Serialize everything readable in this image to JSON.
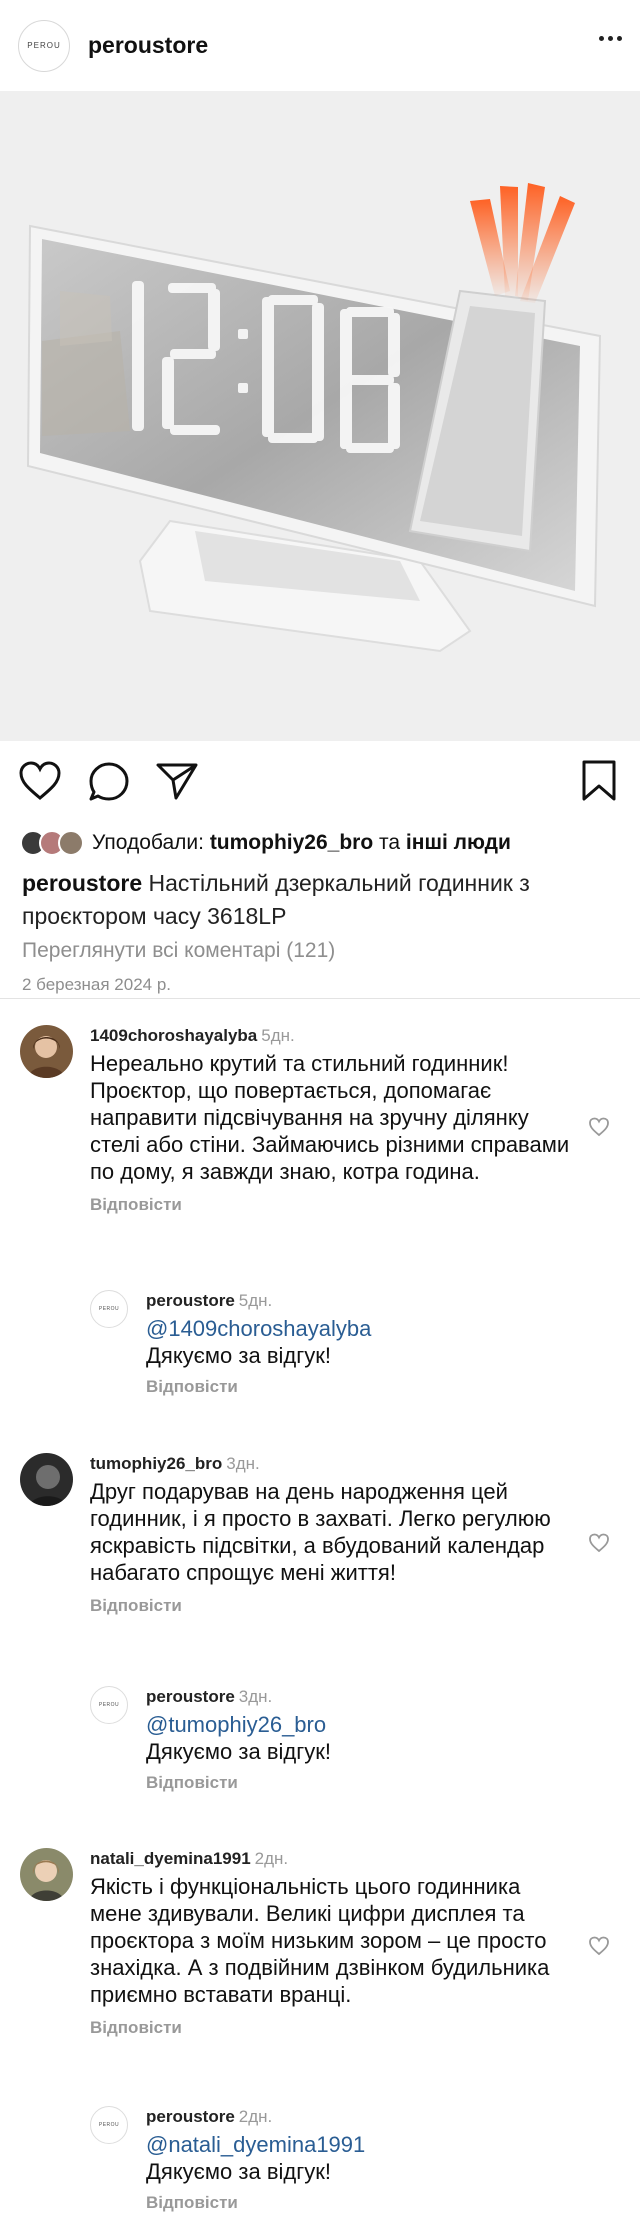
{
  "header": {
    "logo_text": "PEROU",
    "account": "peroustore"
  },
  "post": {
    "likes_prefix": "Уподобали:",
    "likes_user": "tumophiy26_bro",
    "likes_and": "та",
    "likes_others": "інші люди",
    "caption_user": "peroustore",
    "caption_text": "Настільний дзеркальний годинник з проєктором часу 3618LP",
    "view_comments": "Переглянути всі коментарі (121)",
    "date": "2 березная 2024 р."
  },
  "comments": [
    {
      "user": "1409choroshayalyba",
      "time": "5дн.",
      "text": "Нереально крутий та стильний годинник! Проєктор, що повертається, допомагає направити підсвічування на зручну ділянку стелі або стіни. Займаючись різними справами по дому, я завжди знаю, котра година.",
      "reply_label": "Відповісти",
      "avatar_color": "#7a5a3c",
      "reply": {
        "user": "peroustore",
        "time": "5дн.",
        "mention": "@1409choroshayalyba",
        "text": "Дякуємо за відгук!",
        "reply_label": "Відповісти",
        "logo_text": "PEROU"
      }
    },
    {
      "user": "tumophiy26_bro",
      "time": "3дн.",
      "text": "Друг подарував на день народження цей годинник, і я просто в захваті. Легко регулюю яскравість підсвітки, а вбудований календар набагато спрощує мені життя!",
      "reply_label": "Відповісти",
      "avatar_color": "#2b2b2b",
      "reply": {
        "user": "peroustore",
        "time": "3дн.",
        "mention": "@tumophiy26_bro",
        "text": "Дякуємо за відгук!",
        "reply_label": "Відповісти",
        "logo_text": "PEROU"
      }
    },
    {
      "user": "natali_dyemina1991",
      "time": "2дн.",
      "text": "Якість і функціональність цього годинника мене здивували. Великі цифри дисплея та проєктора з моїм низьким зором – це просто знахідка. А з подвійним дзвінком будильника приємно вставати вранці.",
      "reply_label": "Відповісти",
      "avatar_color": "#8a8a6a",
      "reply": {
        "user": "peroustore",
        "time": "2дн.",
        "mention": "@natali_dyemina1991",
        "text": "Дякуємо за відгук!",
        "reply_label": "Відповісти",
        "logo_text": "PEROU"
      }
    }
  ],
  "icons": {
    "like": "heart-icon",
    "comment": "comment-icon",
    "share": "send-icon",
    "save": "bookmark-icon",
    "more": "more-dots-icon"
  }
}
